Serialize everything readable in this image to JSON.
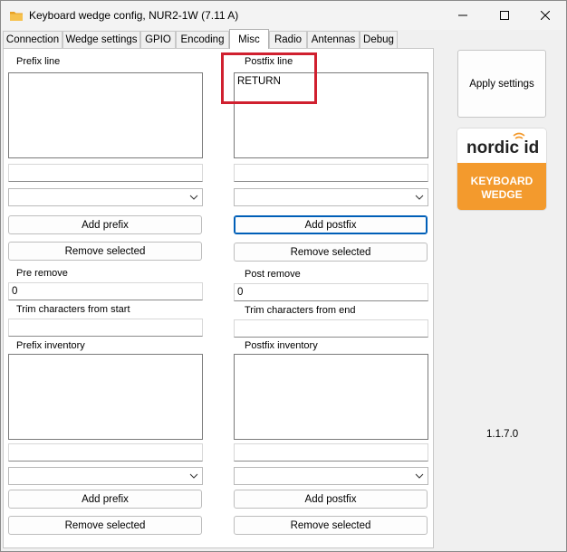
{
  "window": {
    "title": "Keyboard wedge config, NUR2-1W  (7.11 A)",
    "icons": {
      "app": "folder-icon",
      "minimize": "minimize-icon",
      "maximize": "maximize-icon",
      "close": "close-icon"
    }
  },
  "tabs": [
    {
      "label": "Connection",
      "active": false
    },
    {
      "label": "Wedge settings",
      "active": false
    },
    {
      "label": "GPIO",
      "active": false
    },
    {
      "label": "Encoding",
      "active": false
    },
    {
      "label": "Misc",
      "active": true
    },
    {
      "label": "Radio",
      "active": false
    },
    {
      "label": "Antennas",
      "active": false
    },
    {
      "label": "Debug",
      "active": false
    }
  ],
  "prefix": {
    "line_label": "Prefix line",
    "line_value": "",
    "text_value": "",
    "combo_value": "",
    "add_label": "Add prefix",
    "remove_label": "Remove selected",
    "pre_remove_label": "Pre remove",
    "pre_remove_value": "0",
    "trim_label": "Trim characters from start",
    "trim_value": "",
    "inventory_label": "Prefix inventory",
    "inventory_value": "",
    "inv_text_value": "",
    "inv_combo_value": "",
    "inv_add_label": "Add prefix",
    "inv_remove_label": "Remove selected"
  },
  "postfix": {
    "line_label": "Postfix line",
    "line_value": "RETURN",
    "text_value": "",
    "combo_value": "",
    "add_label": "Add postfix",
    "remove_label": "Remove selected",
    "post_remove_label": "Post remove",
    "post_remove_value": "0",
    "trim_label": "Trim characters from end",
    "trim_value": "",
    "inventory_label": "Postfix inventory",
    "inventory_value": "",
    "inv_text_value": "",
    "inv_combo_value": "",
    "inv_add_label": "Add postfix",
    "inv_remove_label": "Remove selected"
  },
  "side": {
    "apply_label": "Apply settings",
    "logo": {
      "brand": "nordic id",
      "line1": "KEYBOARD",
      "line2": "WEDGE"
    },
    "version": "1.1.7.0"
  },
  "colors": {
    "highlight": "#d0202f",
    "logo_orange": "#f39a2d",
    "focus_blue": "#005fb8"
  }
}
